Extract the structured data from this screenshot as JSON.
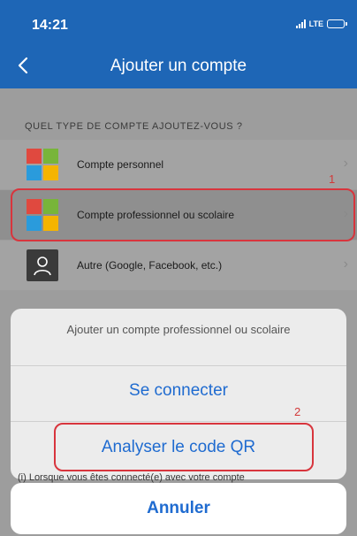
{
  "status_bar": {
    "time": "14:21",
    "network": "LTE"
  },
  "nav": {
    "title": "Ajouter un compte"
  },
  "section": {
    "label": "QUEL TYPE DE COMPTE AJOUTEZ-VOUS ?"
  },
  "accounts": [
    {
      "label": "Compte personnel",
      "icon": "microsoft-logo-icon"
    },
    {
      "label": "Compte professionnel ou scolaire",
      "icon": "microsoft-logo-icon"
    },
    {
      "label": "Autre (Google, Facebook, etc.)",
      "icon": "person-icon"
    }
  ],
  "annotations": {
    "step_1": "1",
    "step_2": "2",
    "highlight_color": "#d8353d"
  },
  "sheet": {
    "title": "Ajouter un compte professionnel ou scolaire",
    "sign_in": "Se connecter",
    "scan_qr": "Analyser le code QR",
    "cancel": "Annuler"
  },
  "footnote": "(i)  Lorsque vous êtes connecté(e) avec votre compte",
  "colors": {
    "header": "#1e66b6",
    "action": "#1f6bd0"
  }
}
